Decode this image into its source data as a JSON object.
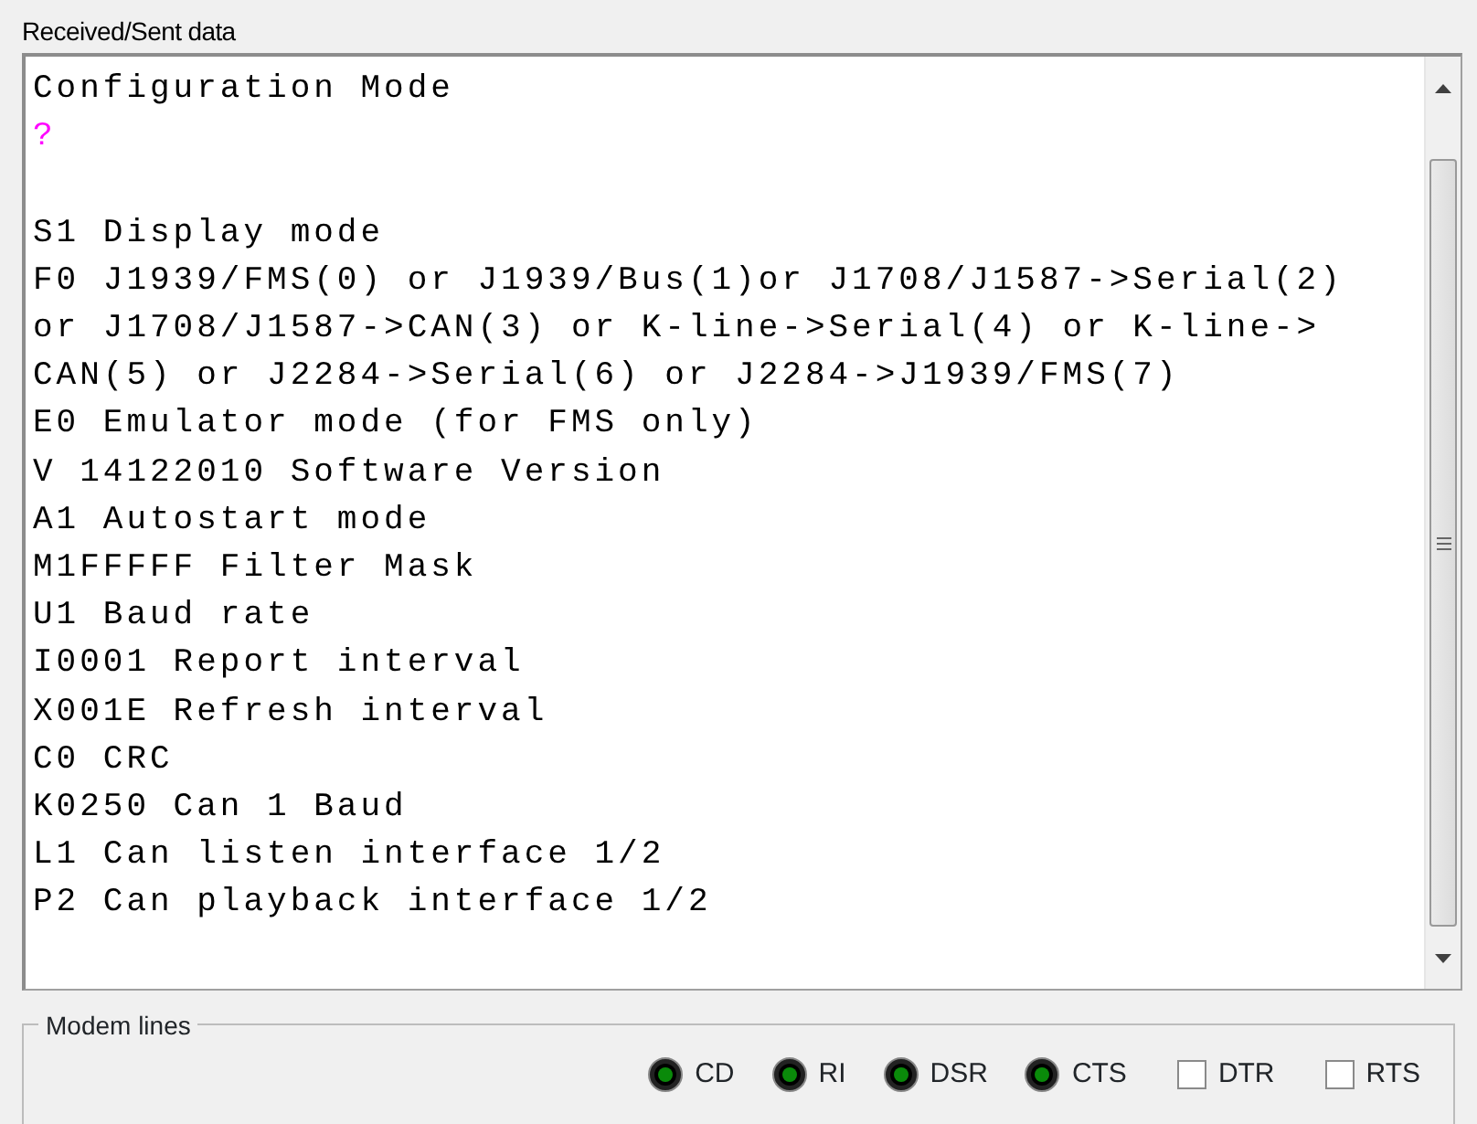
{
  "log_panel": {
    "title": "Received/Sent data",
    "lines": [
      {
        "text": "Configuration Mode",
        "color": "#000000",
        "blank_before": false
      },
      {
        "text": "?",
        "color": "#ff00ff",
        "blank_before": false
      },
      {
        "text": "S1 Display mode",
        "color": "#000000",
        "blank_before": true
      },
      {
        "text": "F0 J1939/FMS(0) or J1939/Bus(1)or J1708/J1587->Serial(2)",
        "color": "#000000",
        "blank_before": false
      },
      {
        "text": "or J1708/J1587->CAN(3) or K-line->Serial(4) or K-line->",
        "color": "#000000",
        "blank_before": false
      },
      {
        "text": "CAN(5) or J2284->Serial(6) or J2284->J1939/FMS(7)",
        "color": "#000000",
        "blank_before": false
      },
      {
        "text": "E0 Emulator mode (for FMS only)",
        "color": "#000000",
        "blank_before": false
      },
      {
        "text": "V 14122010 Software Version",
        "color": "#000000",
        "blank_before": false
      },
      {
        "text": "A1 Autostart mode",
        "color": "#000000",
        "blank_before": false
      },
      {
        "text": "M1FFFFF Filter Mask",
        "color": "#000000",
        "blank_before": false
      },
      {
        "text": "U1 Baud rate",
        "color": "#000000",
        "blank_before": false
      },
      {
        "text": "I0001 Report interval",
        "color": "#000000",
        "blank_before": false
      },
      {
        "text": "X001E Refresh interval",
        "color": "#000000",
        "blank_before": false
      },
      {
        "text": "C0 CRC",
        "color": "#000000",
        "blank_before": false
      },
      {
        "text": "K0250 Can 1 Baud",
        "color": "#000000",
        "blank_before": false
      },
      {
        "text": "L1 Can listen interface 1/2",
        "color": "#000000",
        "blank_before": false
      },
      {
        "text": "P2 Can playback interface 1/2",
        "color": "#000000",
        "blank_before": false
      }
    ]
  },
  "modem_lines": {
    "title": "Modem lines",
    "signals": [
      {
        "kind": "led",
        "label": "CD",
        "on": true
      },
      {
        "kind": "led",
        "label": "RI",
        "on": true
      },
      {
        "kind": "led",
        "label": "DSR",
        "on": true
      },
      {
        "kind": "led",
        "label": "CTS",
        "on": true
      },
      {
        "kind": "checkbox",
        "label": "DTR",
        "checked": false
      },
      {
        "kind": "checkbox",
        "label": "RTS",
        "checked": false
      }
    ]
  }
}
